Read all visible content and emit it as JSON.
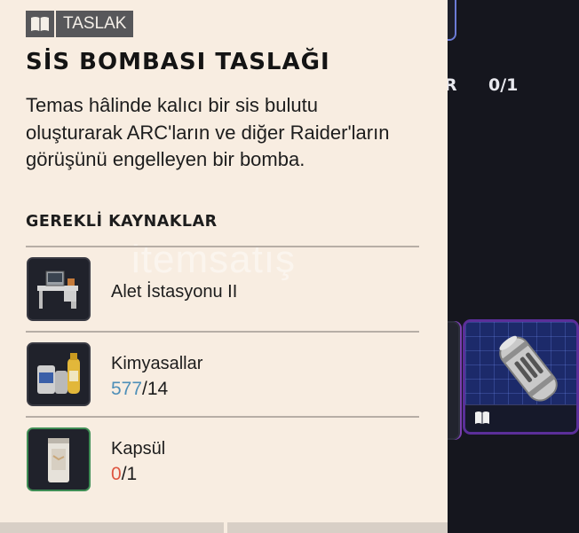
{
  "badge": {
    "label": "TASLAK",
    "icon": "book-icon"
  },
  "title": "SİS BOMBASI TASLAĞI",
  "description": "Temas hâlinde kalıcı bir sis bulutu oluşturarak ARC'ların ve diğer Raider'ların görüşünü engelleyen bir bomba.",
  "section_title": "GEREKLİ KAYNAKLAR",
  "requirements": [
    {
      "name": "Alet İstasyonu II",
      "icon": "workbench-icon"
    },
    {
      "name": "Kimyasallar",
      "have": "577",
      "need": "/14",
      "status": "ok",
      "icon": "chemicals-icon"
    },
    {
      "name": "Kapsül",
      "have": "0",
      "need": "/1",
      "status": "low",
      "icon": "canister-icon"
    }
  ],
  "background": {
    "hud_letter": "R",
    "hud_count": "0/1",
    "card_icon": "book-icon"
  },
  "watermark": "itemsatış",
  "colors": {
    "ok": "#4e8fb8",
    "low": "#de5540",
    "panel": "#f8ede1"
  }
}
